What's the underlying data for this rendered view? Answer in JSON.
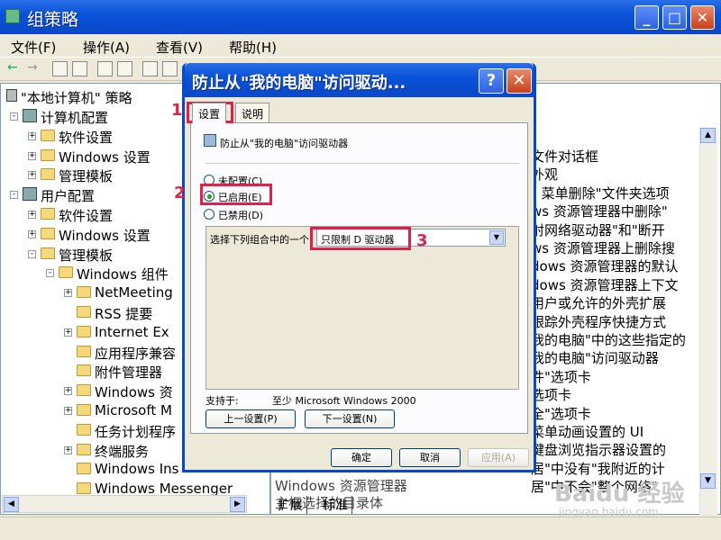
{
  "window": {
    "title": "组策略",
    "buttons": {
      "min": "_",
      "max": "□",
      "close": "✕"
    }
  },
  "menu": [
    "文件(F)",
    "操作(A)",
    "查看(V)",
    "帮助(H)"
  ],
  "tree": {
    "root": "\"本地计算机\" 策略",
    "items": [
      {
        "label": "计算机配置",
        "type": "computer",
        "level": 1,
        "exp": "-"
      },
      {
        "label": "软件设置",
        "type": "folder",
        "level": 2,
        "exp": "+"
      },
      {
        "label": "Windows 设置",
        "type": "folder",
        "level": 2,
        "exp": "+"
      },
      {
        "label": "管理模板",
        "type": "folder",
        "level": 2,
        "exp": "+"
      },
      {
        "label": "用户配置",
        "type": "user",
        "level": 1,
        "exp": "-"
      },
      {
        "label": "软件设置",
        "type": "folder",
        "level": 2,
        "exp": "+"
      },
      {
        "label": "Windows 设置",
        "type": "folder",
        "level": 2,
        "exp": "+"
      },
      {
        "label": "管理模板",
        "type": "folder",
        "level": 2,
        "exp": "-"
      },
      {
        "label": "Windows 组件",
        "type": "folder",
        "level": 3,
        "exp": "-"
      },
      {
        "label": "NetMeeting",
        "type": "folder",
        "level": 4,
        "exp": "+"
      },
      {
        "label": "RSS 提要",
        "type": "folder",
        "level": 4,
        "exp": ""
      },
      {
        "label": "Internet Ex",
        "type": "folder",
        "level": 4,
        "exp": "+"
      },
      {
        "label": "应用程序兼容",
        "type": "folder",
        "level": 4,
        "exp": ""
      },
      {
        "label": "附件管理器",
        "type": "folder",
        "level": 4,
        "exp": ""
      },
      {
        "label": "Windows 资",
        "type": "folder",
        "level": 4,
        "exp": "+"
      },
      {
        "label": "Microsoft M",
        "type": "folder",
        "level": 4,
        "exp": "+"
      },
      {
        "label": "任务计划程序",
        "type": "folder",
        "level": 4,
        "exp": ""
      },
      {
        "label": "终端服务",
        "type": "folder",
        "level": 4,
        "exp": "+"
      },
      {
        "label": "Windows Ins",
        "type": "folder",
        "level": 4,
        "exp": ""
      },
      {
        "label": "Windows Messenger",
        "type": "folder",
        "level": 4,
        "exp": ""
      }
    ]
  },
  "right_pane": {
    "lines": [
      "文件对话框",
      "外观",
      "\" 菜单删除\"文件夹选项",
      "ws 资源管理器中删除\"",
      "射网络驱动器\"和\"断开",
      "ws 资源管理器上删除搜",
      "dows 资源管理器的默认",
      "dows 资源管理器上下文",
      "用户或允许的外壳扩展",
      "跟踪外壳程序快捷方式",
      "我的电脑\"中的这些指定的",
      "我的电脑\"访问驱动器",
      "件\"选项卡",
      "选项卡",
      "全\"选项卡",
      "菜单动画设置的 UI",
      "键盘浏览指示器设置的",
      "居\"中没有\"我附近的计",
      "居\"中不会\"整个网络\""
    ],
    "bottom_text": "Windows 资源管理器",
    "bottom_text2": "主框选择的目录体"
  },
  "bottom_tabs": [
    "扩展",
    "标准"
  ],
  "dialog": {
    "title": "防止从\"我的电脑\"访问驱动...",
    "help": "?",
    "close": "✕",
    "tabs": [
      "设置",
      "说明"
    ],
    "policy_name": "防止从\"我的电脑\"访问驱动器",
    "radios": [
      {
        "label": "未配置(C)",
        "checked": false
      },
      {
        "label": "已启用(E)",
        "checked": true
      },
      {
        "label": "已禁用(D)",
        "checked": false
      }
    ],
    "combo_label": "选择下列组合中的一个",
    "combo_value": "只限制 D 驱动器",
    "supported_label": "支持于:",
    "supported_value": "至少 Microsoft Windows 2000",
    "prev_button": "上一设置(P)",
    "next_button": "下一设置(N)",
    "ok": "确定",
    "cancel": "取消",
    "apply": "应用(A)"
  },
  "markers": [
    "1",
    "2",
    "3"
  ],
  "watermark": "Baidu 经验",
  "watermark_sub": "jingyan.baidu.com"
}
